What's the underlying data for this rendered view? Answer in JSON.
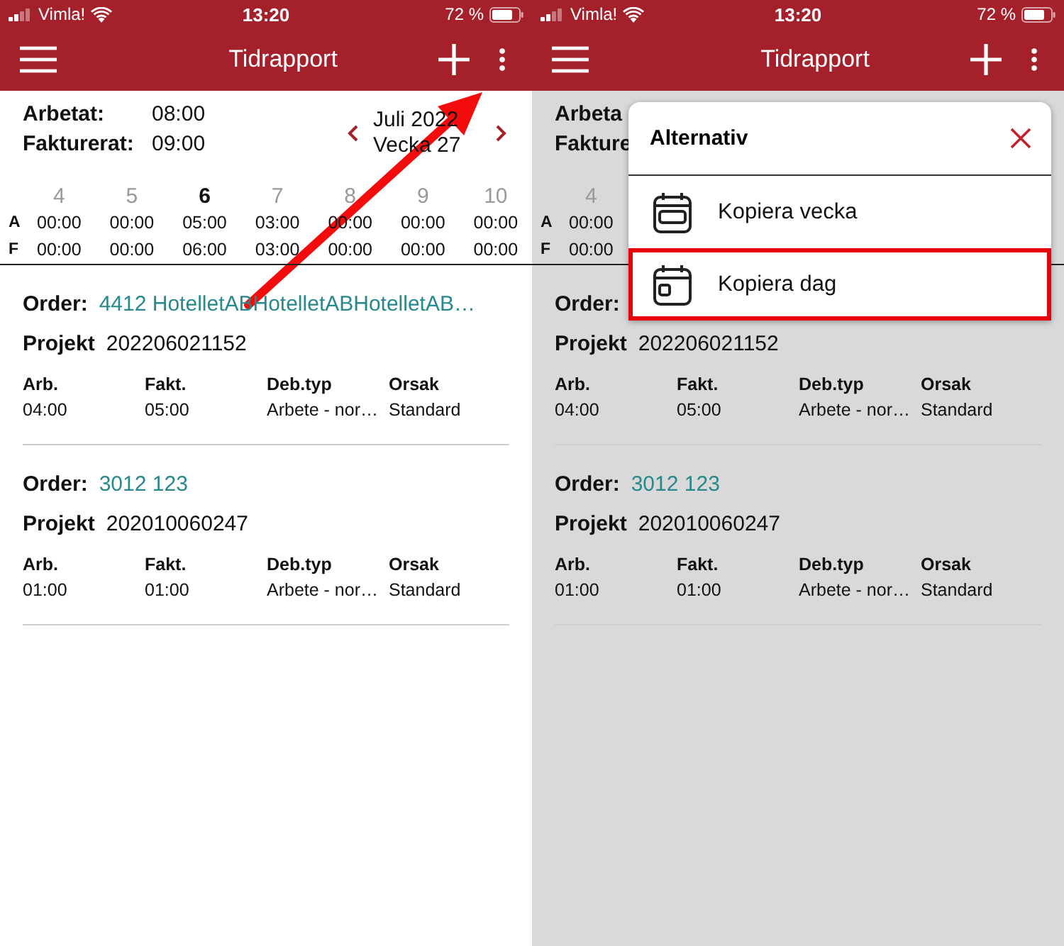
{
  "screens": [
    {
      "dimmed": false,
      "status_bar": {
        "carrier": "Vimla!",
        "time": "13:20",
        "battery": "72 %"
      },
      "header": {
        "title": "Tidrapport"
      },
      "summary": {
        "rows": [
          {
            "label": "Arbetat:",
            "value": "08:00"
          },
          {
            "label": "Fakturerat:",
            "value": "09:00"
          }
        ],
        "period": {
          "month": "Juli 2022",
          "week": "Vecka 27"
        }
      },
      "week": {
        "row_labels": [
          "A",
          "F"
        ],
        "days": [
          {
            "day": "4",
            "selected": false,
            "worked": "00:00",
            "invoiced": "00:00"
          },
          {
            "day": "5",
            "selected": false,
            "worked": "00:00",
            "invoiced": "00:00"
          },
          {
            "day": "6",
            "selected": true,
            "worked": "05:00",
            "invoiced": "06:00"
          },
          {
            "day": "7",
            "selected": false,
            "worked": "03:00",
            "invoiced": "03:00"
          },
          {
            "day": "8",
            "selected": false,
            "worked": "00:00",
            "invoiced": "00:00"
          },
          {
            "day": "9",
            "selected": false,
            "worked": "00:00",
            "invoiced": "00:00"
          },
          {
            "day": "10",
            "selected": false,
            "worked": "00:00",
            "invoiced": "00:00"
          }
        ]
      },
      "entries": [
        {
          "order_label": "Order:",
          "order": "4412 HotelletABHotelletABHotelletAB…",
          "project_label": "Projekt",
          "project": "202206021152",
          "columns": [
            {
              "heading": "Arb.",
              "value": "04:00"
            },
            {
              "heading": "Fakt.",
              "value": "05:00"
            },
            {
              "heading": "Deb.typ",
              "value": "Arbete - nor…"
            },
            {
              "heading": "Orsak",
              "value": "Standard"
            }
          ]
        },
        {
          "order_label": "Order:",
          "order": "3012 123",
          "project_label": "Projekt",
          "project": "202010060247",
          "columns": [
            {
              "heading": "Arb.",
              "value": "01:00"
            },
            {
              "heading": "Fakt.",
              "value": "01:00"
            },
            {
              "heading": "Deb.typ",
              "value": "Arbete - nor…"
            },
            {
              "heading": "Orsak",
              "value": "Standard"
            }
          ]
        }
      ],
      "annotation": {
        "kind": "arrow"
      }
    },
    {
      "dimmed": true,
      "status_bar": {
        "carrier": "Vimla!",
        "time": "13:20",
        "battery": "72 %"
      },
      "header": {
        "title": "Tidrapport"
      },
      "summary": {
        "rows": [
          {
            "label": "Arbeta"
          },
          {
            "label": "Fakture"
          }
        ]
      },
      "week": {
        "row_labels": [
          "A",
          "F"
        ],
        "days": [
          {
            "day": "4",
            "selected": false,
            "worked": "00:00",
            "invoiced": "00:00"
          }
        ]
      },
      "entries": [
        {
          "order_label": "Order:",
          "project_label": "Projekt",
          "project": "202206021152",
          "columns": [
            {
              "heading": "Arb.",
              "value": "04:00"
            },
            {
              "heading": "Fakt.",
              "value": "05:00"
            },
            {
              "heading": "Deb.typ",
              "value": "Arbete - nor…"
            },
            {
              "heading": "Orsak",
              "value": "Standard"
            }
          ]
        },
        {
          "order_label": "Order:",
          "order": "3012 123",
          "project_label": "Projekt",
          "project": "202010060247",
          "columns": [
            {
              "heading": "Arb.",
              "value": "01:00"
            },
            {
              "heading": "Fakt.",
              "value": "01:00"
            },
            {
              "heading": "Deb.typ",
              "value": "Arbete - nor…"
            },
            {
              "heading": "Orsak",
              "value": "Standard"
            }
          ]
        }
      ],
      "dialog": {
        "title": "Alternativ",
        "items": [
          {
            "label": "Kopiera vecka",
            "kind": "week",
            "highlighted": false
          },
          {
            "label": "Kopiera dag",
            "kind": "day",
            "highlighted": true
          }
        ]
      }
    }
  ]
}
